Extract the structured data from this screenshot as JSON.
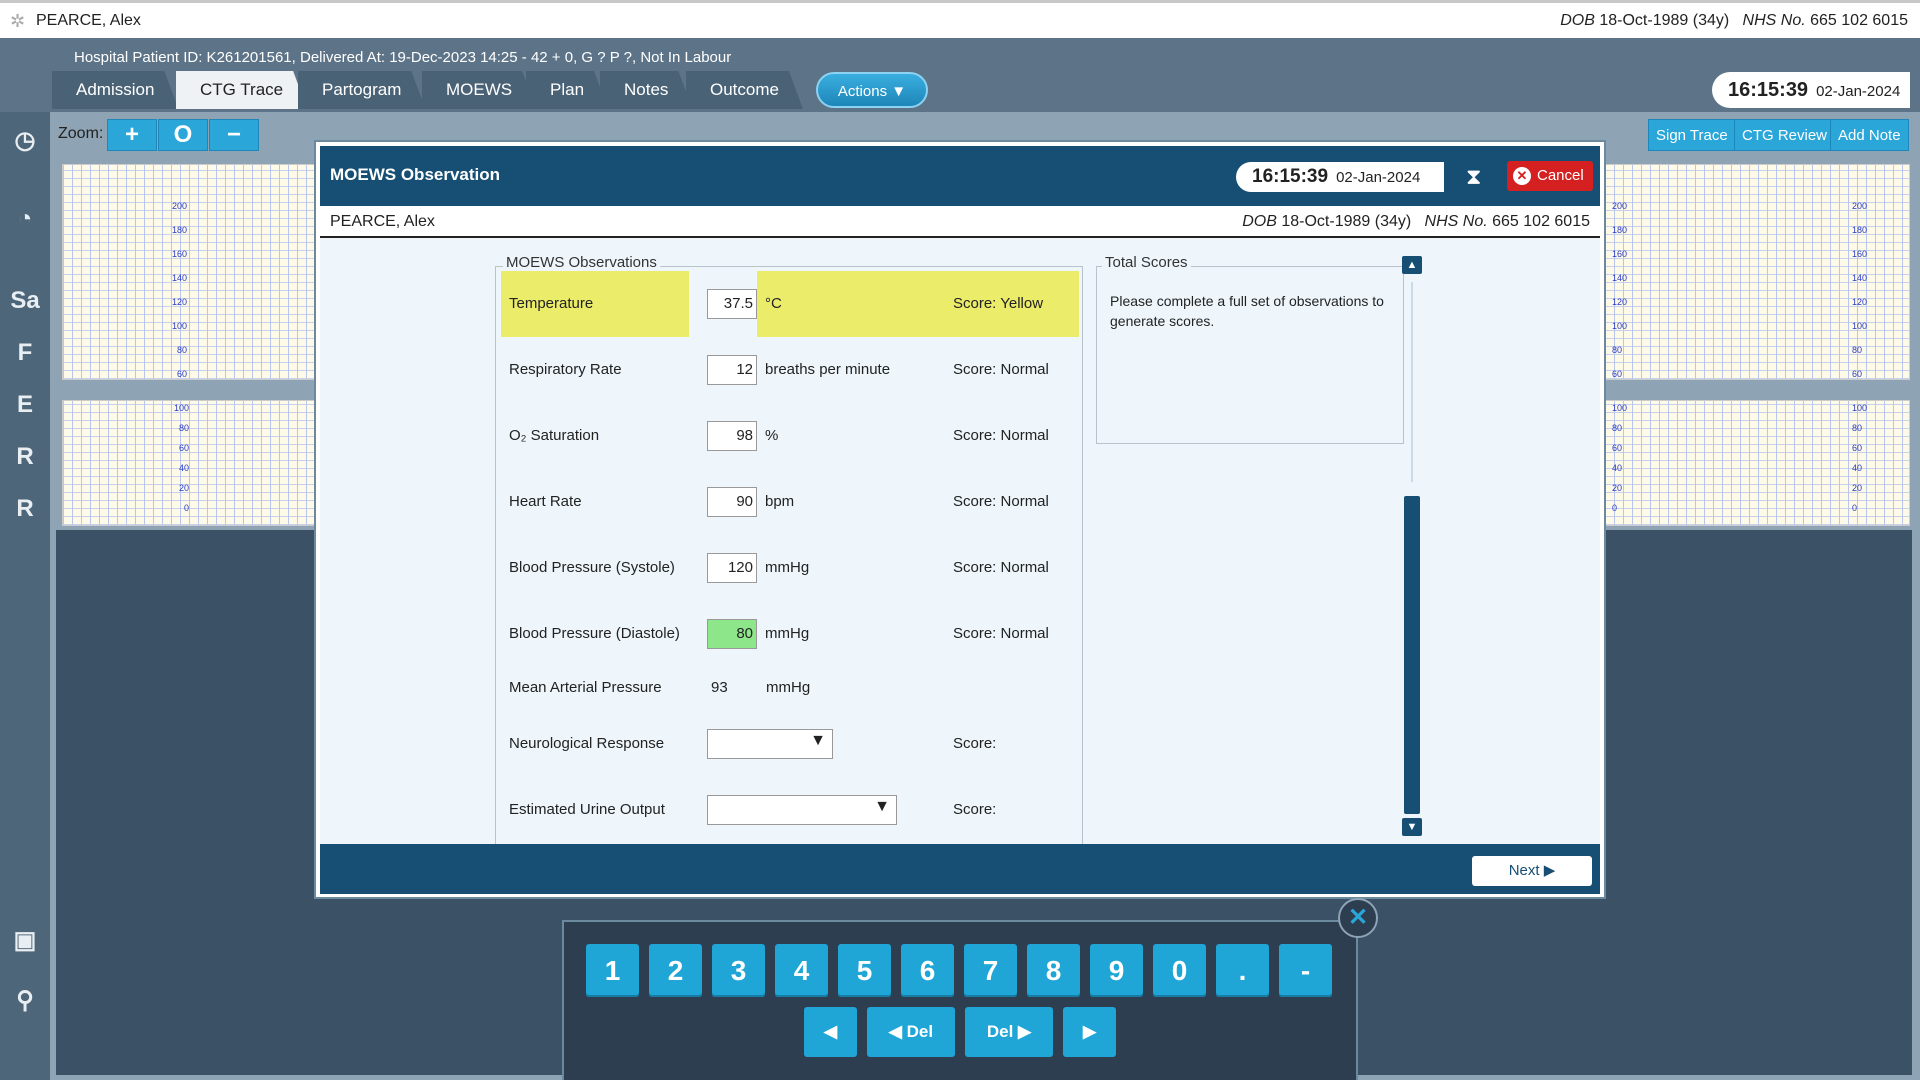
{
  "topbar": {
    "patient_name": "PEARCE, Alex",
    "dob_label": "DOB",
    "dob_value": "18-Oct-1989 (34y)",
    "nhs_label": "NHS No.",
    "nhs_value": "665 102 6015"
  },
  "header": {
    "hospital_line": "Hospital Patient ID: K261201561, Delivered At: 19-Dec-2023 14:25 - 42 + 0, G ? P ?,   Not In Labour",
    "tabs": [
      "Admission",
      "CTG Trace",
      "Partogram",
      "MOEWS",
      "Plan",
      "Notes",
      "Outcome"
    ],
    "actions_label": "Actions",
    "time": "16:15:39",
    "date": "02-Jan-2024"
  },
  "sidebar": {
    "letters": [
      "Sa",
      "F",
      "E",
      "R",
      "R"
    ]
  },
  "toolbar": {
    "zoom_label": "Zoom:",
    "zoom_in": "+",
    "zoom_reset": "O",
    "zoom_out": "−",
    "sign_trace": "Sign Trace",
    "ctg_review": "CTG Review",
    "add_note": "Add Note"
  },
  "ctg": {
    "fhr_ticks": [
      "200",
      "180",
      "160",
      "140",
      "120",
      "100",
      "80",
      "60"
    ],
    "toco_ticks": [
      "100",
      "80",
      "60",
      "40",
      "20",
      "0"
    ]
  },
  "modal": {
    "title": "MOEWS Observation",
    "time": "16:15:39",
    "date": "02-Jan-2024",
    "cancel_label": "Cancel",
    "patient_name": "PEARCE, Alex",
    "dob_label": "DOB",
    "dob_value": "18-Oct-1989 (34y)",
    "nhs_label": "NHS No.",
    "nhs_value": "665 102 6015",
    "obs_legend": "MOEWS Observations",
    "totals_legend": "Total Scores",
    "totals_text": "Please complete a full set of observations to generate scores.",
    "next_label": "Next",
    "observations": [
      {
        "label": "Temperature",
        "value": "37.5",
        "unit": "°C",
        "score": "Score: Yellow"
      },
      {
        "label": "Respiratory Rate",
        "value": "12",
        "unit": "breaths per minute",
        "score": "Score: Normal"
      },
      {
        "label": "O₂ Saturation",
        "value": "98",
        "unit": "%",
        "score": "Score: Normal"
      },
      {
        "label": "Heart Rate",
        "value": "90",
        "unit": "bpm",
        "score": "Score: Normal"
      },
      {
        "label": "Blood Pressure (Systole)",
        "value": "120",
        "unit": "mmHg",
        "score": "Score: Normal"
      },
      {
        "label": "Blood Pressure (Diastole)",
        "value": "80",
        "unit": "mmHg",
        "score": "Score: Normal"
      }
    ],
    "map": {
      "label": "Mean Arterial Pressure",
      "value": "93",
      "unit": "mmHg"
    },
    "neuro": {
      "label": "Neurological Response",
      "score": "Score:"
    },
    "urine": {
      "label": "Estimated Urine Output",
      "score": "Score:"
    }
  },
  "numpad": {
    "keys": [
      "1",
      "2",
      "3",
      "4",
      "5",
      "6",
      "7",
      "8",
      "9",
      "0",
      ".",
      "-"
    ],
    "left": "◀",
    "del_left": "◀ Del",
    "del_right": "Del ▶",
    "right": "▶",
    "close": "✕"
  },
  "colors": {
    "header_blue": "#164f73",
    "accent": "#2aa6d9",
    "yellow_highlight": "#ebec6a",
    "green_input": "#8ee68a",
    "cancel_red": "#d42020"
  }
}
